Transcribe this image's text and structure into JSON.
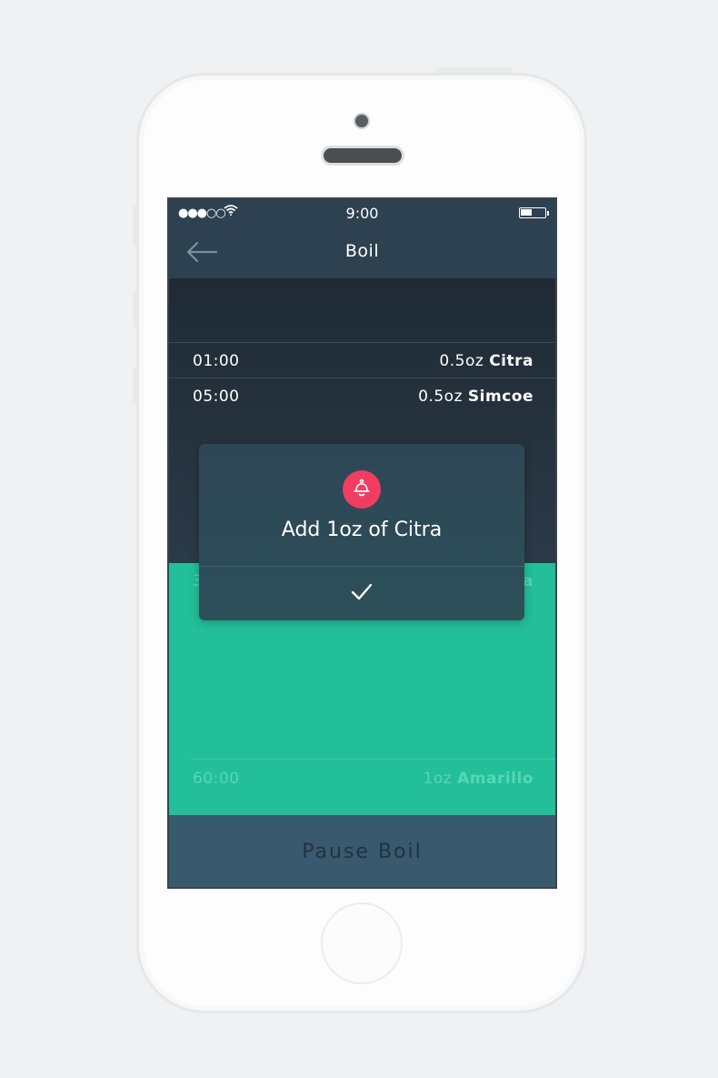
{
  "status_bar": {
    "signal": "●●●○○",
    "time": "9:00"
  },
  "navbar": {
    "title": "Boil",
    "back_icon": "arrow-left-icon"
  },
  "schedule": [
    {
      "time": "01:00",
      "amount": "0.5oz",
      "hop": "Citra"
    },
    {
      "time": "05:00",
      "amount": "0.5oz",
      "hop": "Simcoe"
    }
  ],
  "hidden_row": {
    "time_fragment": "3",
    "hop_fragment": "a"
  },
  "upcoming": {
    "time": "60:00",
    "amount": "1oz",
    "hop": "Amarillo"
  },
  "modal": {
    "icon": "bell-icon",
    "message": "Add 1oz of Citra",
    "confirm_icon": "checkmark-icon"
  },
  "bottom": {
    "pause_label": "Pause Boil"
  },
  "colors": {
    "accent_green": "#23bf99",
    "alert_red": "#f23d62",
    "navbar": "#2d4150"
  }
}
